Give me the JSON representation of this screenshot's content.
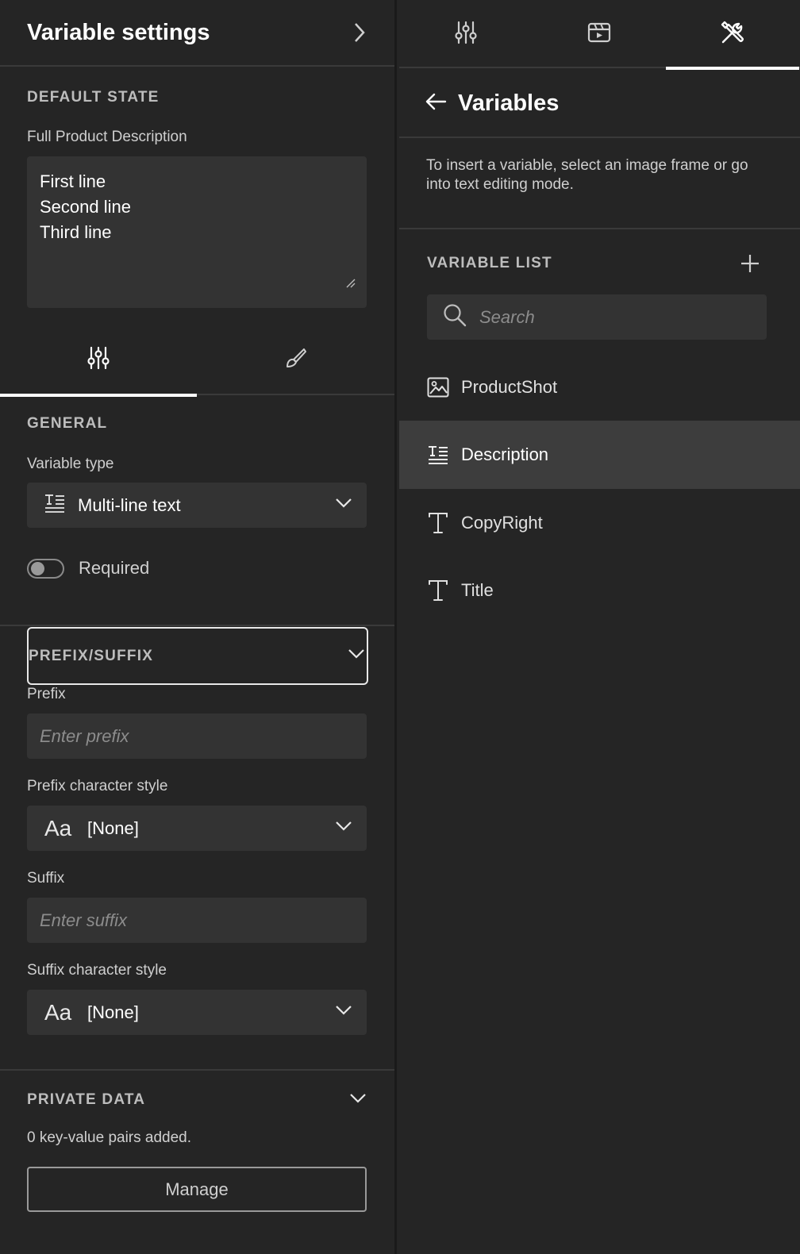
{
  "left_panel": {
    "title": "Variable settings",
    "default_state": {
      "section_label": "DEFAULT STATE",
      "field_label": "Full Product Description",
      "value_lines": [
        "First line",
        "Second line",
        "Third line"
      ]
    },
    "general": {
      "section_label": "GENERAL",
      "variable_type_label": "Variable type",
      "variable_type_value": "Multi-line text",
      "required_label": "Required",
      "required_on": false
    },
    "prefix_suffix": {
      "section_label": "PREFIX/SUFFIX",
      "prefix_label": "Prefix",
      "prefix_placeholder": "Enter prefix",
      "prefix_style_label": "Prefix character style",
      "prefix_style_value": "[None]",
      "suffix_label": "Suffix",
      "suffix_placeholder": "Enter suffix",
      "suffix_style_label": "Suffix character style",
      "suffix_style_value": "[None]",
      "style_icon_text": "Aa"
    },
    "private_data": {
      "section_label": "PRIVATE DATA",
      "summary": "0 key-value pairs added.",
      "manage_label": "Manage"
    }
  },
  "right_panel": {
    "active_tab": "tools",
    "title": "Variables",
    "hint": "To insert a variable, select an image frame or go into text editing mode.",
    "list_label": "VARIABLE LIST",
    "search_placeholder": "Search",
    "variables": [
      {
        "name": "ProductShot",
        "icon": "image-icon",
        "selected": false
      },
      {
        "name": "Description",
        "icon": "multiline-text-icon",
        "selected": true
      },
      {
        "name": "CopyRight",
        "icon": "text-icon",
        "selected": false
      },
      {
        "name": "Title",
        "icon": "text-icon",
        "selected": false
      }
    ]
  },
  "colors": {
    "background": "#252525",
    "field": "#333333",
    "selected_row": "#3d3d3d",
    "text": "#ffffff"
  }
}
